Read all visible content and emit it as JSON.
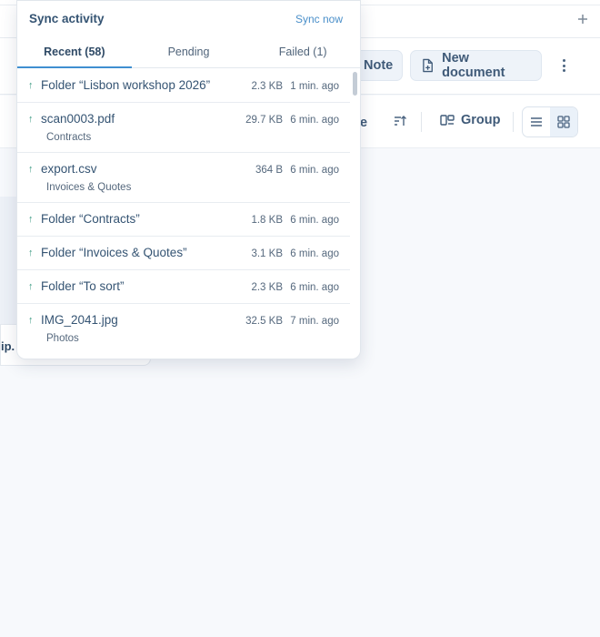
{
  "toolbar": {
    "note_label": "Note",
    "new_document_label": "New document"
  },
  "viewbar": {
    "partial_label": "e",
    "group_label": "Group"
  },
  "background_card": {
    "partial_label": "ip."
  },
  "sync_popover": {
    "title": "Sync activity",
    "sync_now_label": "Sync now",
    "tabs": [
      {
        "label": "Recent (58)",
        "active": true
      },
      {
        "label": "Pending",
        "active": false
      },
      {
        "label": "Failed (1)",
        "active": false
      }
    ],
    "items": [
      {
        "name": "Folder “Lisbon workshop 2026”",
        "location": "",
        "size": "2.3 KB",
        "time": "1 min. ago"
      },
      {
        "name": "scan0003.pdf",
        "location": "Contracts",
        "size": "29.7 KB",
        "time": "6 min. ago"
      },
      {
        "name": "export.csv",
        "location": "Invoices & Quotes",
        "size": "364 B",
        "time": "6 min. ago"
      },
      {
        "name": "Folder “Contracts”",
        "location": "",
        "size": "1.8 KB",
        "time": "6 min. ago"
      },
      {
        "name": "Folder “Invoices & Quotes”",
        "location": "",
        "size": "3.1 KB",
        "time": "6 min. ago"
      },
      {
        "name": "Folder “To sort”",
        "location": "",
        "size": "2.3 KB",
        "time": "6 min. ago"
      },
      {
        "name": "IMG_2041.jpg",
        "location": "Photos",
        "size": "32.5 KB",
        "time": "7 min. ago"
      }
    ],
    "upload_icon": "arrow-up-icon"
  },
  "colors": {
    "accent": "#3f8fd0",
    "upload_arrow": "#3a9a82",
    "title_text": "#355473"
  }
}
